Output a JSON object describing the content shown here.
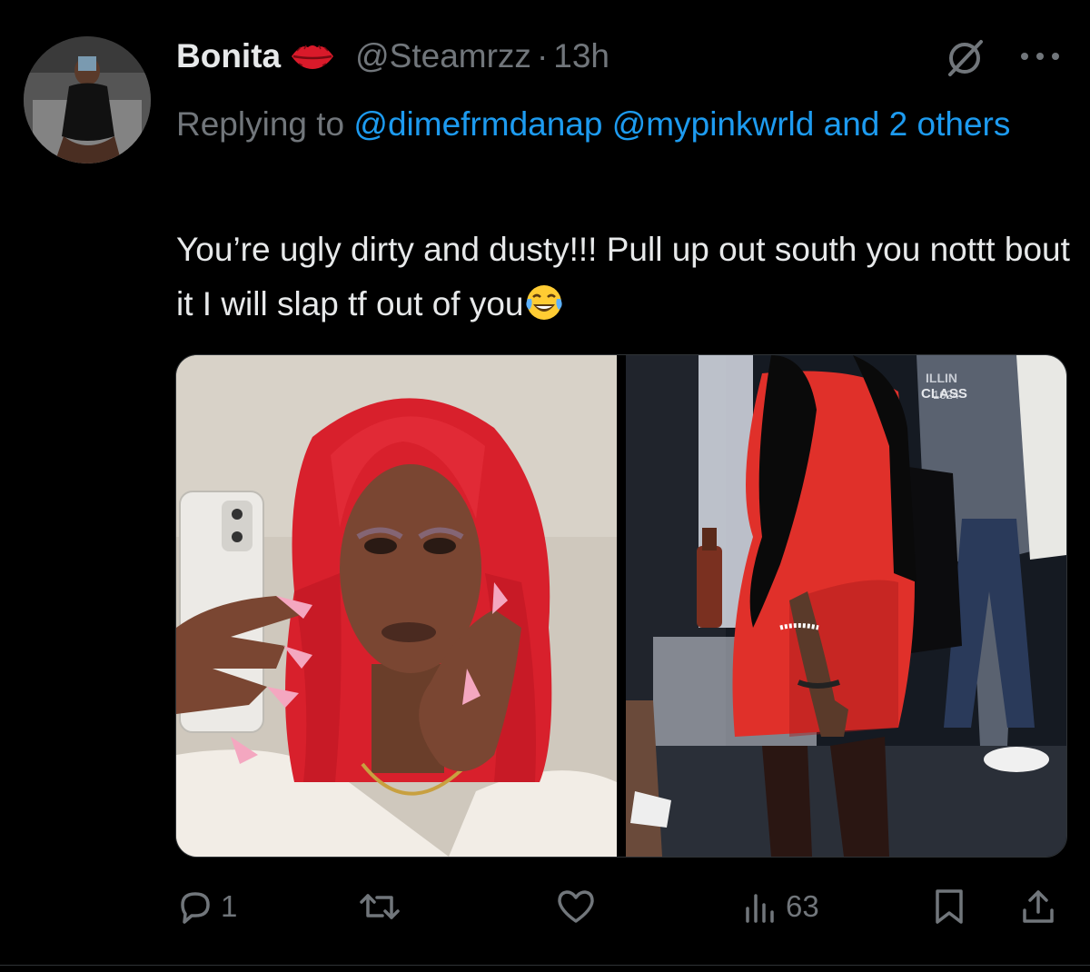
{
  "tweet": {
    "display_name": "Bonita",
    "name_emoji": "lips-icon",
    "handle": "@Steamrzz",
    "separator": "·",
    "time": "13h",
    "replying_prefix": "Replying to",
    "replying_to": [
      "@dimefrmdanap",
      "@mypinkwrld"
    ],
    "replying_others": "and 2 others",
    "text": "You’re ugly dirty and dusty!!! Pull up out south you nottt bout it I will slap tf out of you",
    "text_emoji": "face-with-tears-of-joy-icon",
    "photos": [
      "photo-selfie-red-wig",
      "photo-red-dress-party"
    ],
    "photo_text": {
      "sweatshirt_line1": "ILLIN",
      "sweatshirt_line2": "1624",
      "sweatshirt_line3": "CLASS"
    }
  },
  "actions": {
    "reply_count": "1",
    "retweet_count": "",
    "like_count": "",
    "view_count": "63"
  },
  "colors": {
    "background": "#000000",
    "text_primary": "#e7e9ea",
    "text_secondary": "#71767b",
    "link": "#1d9bf0",
    "divider": "#2f3336"
  }
}
